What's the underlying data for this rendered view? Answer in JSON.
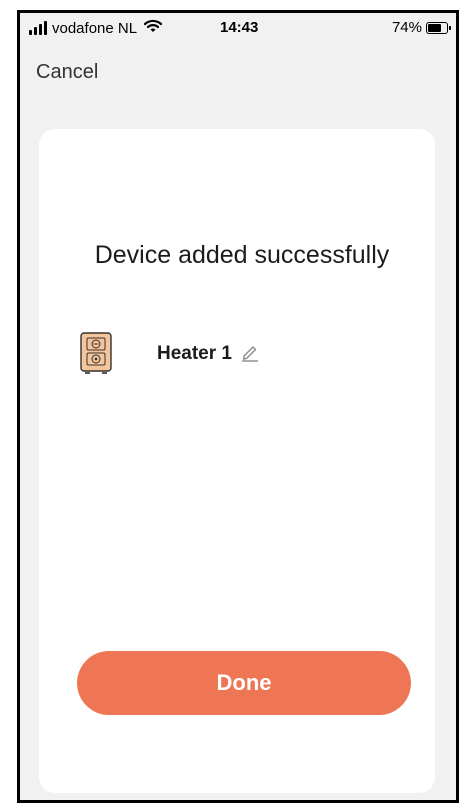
{
  "status_bar": {
    "carrier": "vodafone NL",
    "time": "14:43",
    "battery_percent_text": "74%",
    "battery_level": 0.74,
    "signal_icon": "signal-bars-icon",
    "wifi_icon": "wifi-icon",
    "battery_icon": "battery-icon"
  },
  "nav": {
    "cancel_label": "Cancel"
  },
  "card": {
    "title": "Device added successfully",
    "device": {
      "name": "Heater 1",
      "icon": "heater-icon",
      "edit_icon": "pencil-icon"
    },
    "done_label": "Done"
  },
  "colors": {
    "accent": "#ee7654",
    "background": "#f1f1f1",
    "card": "#ffffff",
    "heater": "#f5c49a"
  }
}
